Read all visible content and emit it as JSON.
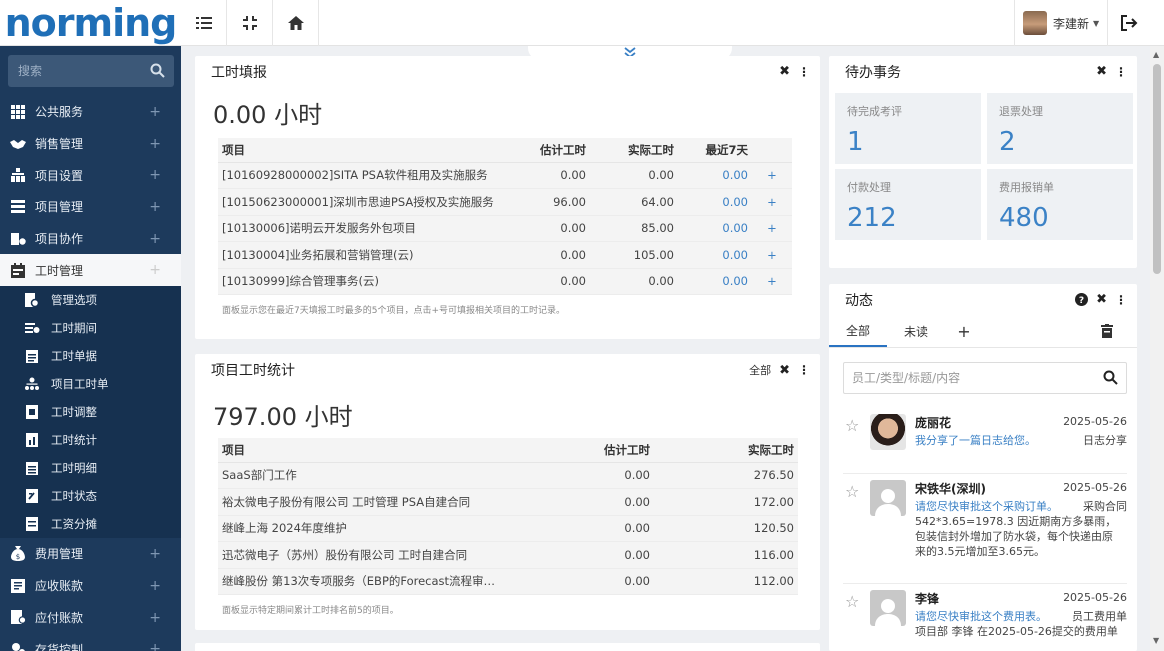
{
  "header": {
    "logo_text": "norming",
    "user_name": "李建新"
  },
  "sidebar": {
    "search_placeholder": "搜索",
    "items": [
      {
        "label": "公共服务",
        "icon": "grid-icon"
      },
      {
        "label": "销售管理",
        "icon": "handshake-icon"
      },
      {
        "label": "项目设置",
        "icon": "org-icon"
      },
      {
        "label": "项目管理",
        "icon": "server-icon"
      },
      {
        "label": "项目协作",
        "icon": "collab-icon"
      },
      {
        "label": "工时管理",
        "icon": "calendar-icon"
      }
    ],
    "sub_items": [
      {
        "label": "管理选项"
      },
      {
        "label": "工时期间"
      },
      {
        "label": "工时单据"
      },
      {
        "label": "项目工时单"
      },
      {
        "label": "工时调整"
      },
      {
        "label": "工时统计"
      },
      {
        "label": "工时明细"
      },
      {
        "label": "工时状态"
      },
      {
        "label": "工资分摊"
      }
    ],
    "bottom_items": [
      {
        "label": "费用管理"
      },
      {
        "label": "应收账款"
      },
      {
        "label": "应付账款"
      },
      {
        "label": "存货控制"
      }
    ]
  },
  "timesheet": {
    "title": "工时填报",
    "total": "0.00 小时",
    "columns": [
      "项目",
      "估计工时",
      "实际工时",
      "最近7天"
    ],
    "rows": [
      {
        "project": "[10160928000002]SITA PSA软件租用及实施服务",
        "est": "0.00",
        "actual": "0.00",
        "last7": "0.00"
      },
      {
        "project": "[10150623000001]深圳市思迪PSA授权及实施服务",
        "est": "96.00",
        "actual": "64.00",
        "last7": "0.00"
      },
      {
        "project": "[10130006]诺明云开发服务外包项目",
        "est": "0.00",
        "actual": "85.00",
        "last7": "0.00"
      },
      {
        "project": "[10130004]业务拓展和营销管理(云)",
        "est": "0.00",
        "actual": "105.00",
        "last7": "0.00"
      },
      {
        "project": "[10130999]综合管理事务(云)",
        "est": "0.00",
        "actual": "0.00",
        "last7": "0.00"
      }
    ],
    "plus": "+",
    "note": "面板显示您在最近7天填报工时最多的5个项目，点击+号可填报相关项目的工时记录。"
  },
  "stats": {
    "title": "项目工时统计",
    "filter_label": "全部",
    "total": "797.00 小时",
    "columns": [
      "项目",
      "估计工时",
      "实际工时"
    ],
    "rows": [
      {
        "project": "SaaS部门工作",
        "est": "0.00",
        "actual": "276.50"
      },
      {
        "project": "裕太微电子股份有限公司 工时管理 PSA自建合同",
        "est": "0.00",
        "actual": "172.00"
      },
      {
        "project": "继峰上海 2024年度维护",
        "est": "0.00",
        "actual": "120.50"
      },
      {
        "project": "迅芯微电子（苏州）股份有限公司 工时自建合同",
        "est": "0.00",
        "actual": "116.00"
      },
      {
        "project": "继峰股份 第13次专项服务（EBP的Forecast流程审…",
        "est": "0.00",
        "actual": "112.00"
      }
    ],
    "note": "面板显示特定期间累计工时排名前5的项目。"
  },
  "todo": {
    "title": "待办事务",
    "tiles": [
      {
        "label": "待完成考评",
        "value": "1"
      },
      {
        "label": "退票处理",
        "value": "2"
      },
      {
        "label": "付款处理",
        "value": "212"
      },
      {
        "label": "费用报销单",
        "value": "480"
      }
    ]
  },
  "activity": {
    "title": "动态",
    "tabs": [
      "全部",
      "未读",
      "+"
    ],
    "search_placeholder": "员工/类型/标题/内容",
    "items": [
      {
        "name": "庞丽花",
        "date": "2025-05-26",
        "message": "我分享了一篇日志给您。",
        "kind": "日志分享",
        "detail": ""
      },
      {
        "name": "宋铁华(深圳)",
        "date": "2025-05-26",
        "message": "请您尽快审批这个采购订单。",
        "kind": "采购合同",
        "detail": "542*3.65=1978.3 因近期南方多暴雨，包装信封外增加了防水袋，每个快递由原来的3.5元增加至3.65元。"
      },
      {
        "name": "李锋",
        "date": "2025-05-26",
        "message": "请您尽快审批这个费用表。",
        "kind": "员工费用单",
        "detail": "项目部 李锋 在2025-05-26提交的费用单"
      }
    ]
  }
}
